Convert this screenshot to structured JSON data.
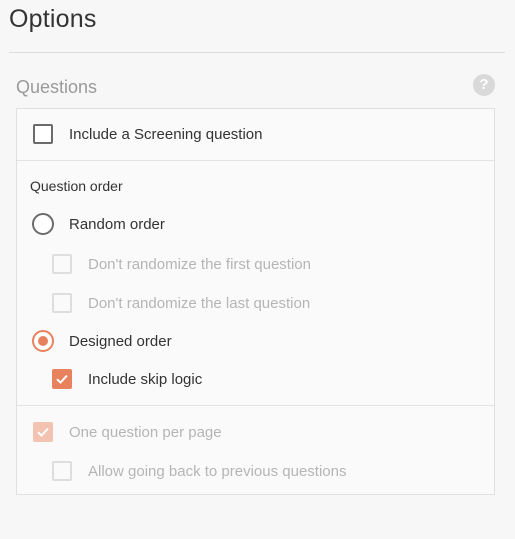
{
  "page": {
    "title": "Options"
  },
  "section": {
    "title": "Questions",
    "help_icon": "question-mark-icon",
    "help_glyph": "?"
  },
  "screening": {
    "label": "Include a Screening question",
    "checked": false
  },
  "question_order": {
    "label": "Question order",
    "random": {
      "label": "Random order",
      "selected": false,
      "options": {
        "first": {
          "label": "Don't randomize the first question",
          "checked": false,
          "disabled": true
        },
        "last": {
          "label": "Don't randomize the last question",
          "checked": false,
          "disabled": true
        }
      }
    },
    "designed": {
      "label": "Designed order",
      "selected": true,
      "skip_logic": {
        "label": "Include skip logic",
        "checked": true
      }
    }
  },
  "paging": {
    "one_per_page": {
      "label": "One question per page",
      "checked": true,
      "disabled": true
    },
    "go_back": {
      "label": "Allow going back to previous questions",
      "checked": false,
      "disabled": true
    }
  },
  "colors": {
    "accent": "#e8825e",
    "accent_disabled": "#f3c3b1"
  }
}
